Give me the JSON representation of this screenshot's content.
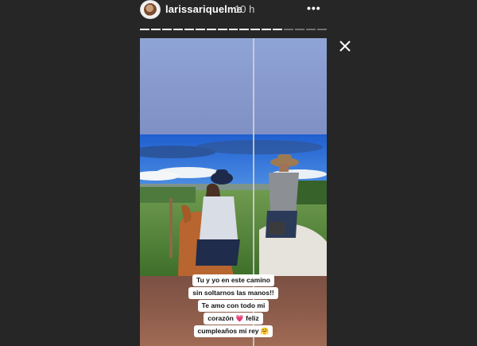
{
  "header": {
    "username": "larissariquelme",
    "time": "10 h",
    "more_label": "•••"
  },
  "progress": {
    "segments_total": 17,
    "segments_done": 13
  },
  "story": {
    "caption_lines": [
      "Tu y yo en este camino",
      "sin soltarnos las manos!!",
      "Te amo con todo mi",
      "corazón 💗 feliz",
      "cumpleaños mi rey 🤗"
    ]
  },
  "colors": {
    "background": "#262626",
    "text": "#ffffff"
  }
}
